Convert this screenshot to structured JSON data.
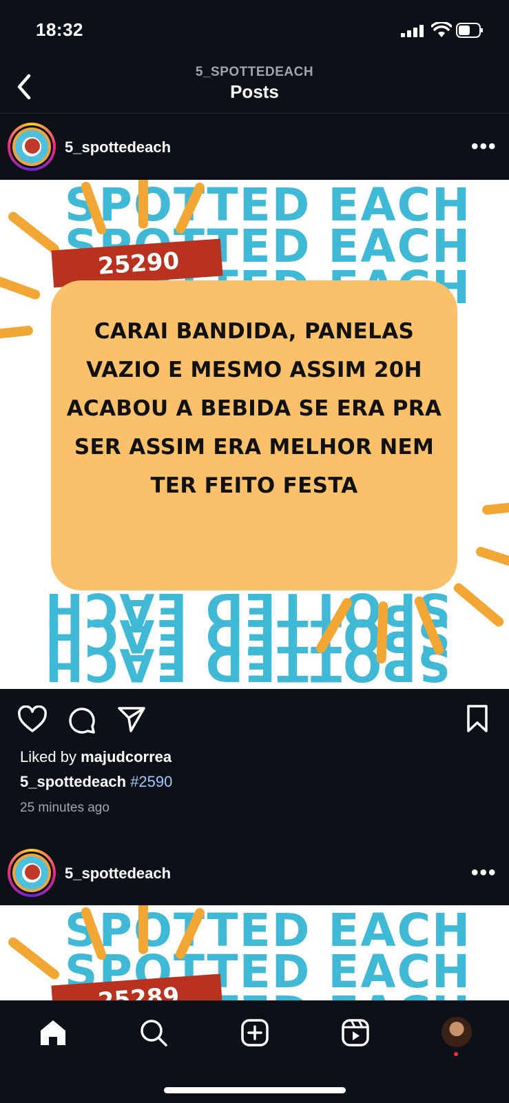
{
  "status_bar": {
    "time": "18:32",
    "icons": [
      "signal-icon",
      "wifi-icon",
      "battery-icon"
    ]
  },
  "header": {
    "username": "5_SPOTTEDEACH",
    "title": "Posts",
    "back_icon": "chevron-left-icon"
  },
  "posts": [
    {
      "username": "5_spottedeach",
      "image": {
        "background_word": "SPOTTED EACH",
        "number": "25290",
        "text": "CARAI BANDIDA, PANELAS VAZIO E MESMO ASSIM 20H ACABOU A BEBIDA SE ERA PRA SER ASSIM ERA MELHOR NEM TER FEITO FESTA",
        "colors": {
          "card": "#fbc16a",
          "tag": "#b8321f",
          "word": "#3fb9d6",
          "rays": "#f2a735"
        }
      },
      "likes_prefix": "Liked by ",
      "liked_by": "majudcorrea",
      "caption_user": "5_spottedeach",
      "caption_tag": "#2590",
      "time_ago": "25 minutes ago"
    },
    {
      "username": "5_spottedeach",
      "image": {
        "background_word": "SPOTTED EACH",
        "number": "25289"
      }
    }
  ],
  "nav": {
    "items": [
      "home-icon",
      "search-icon",
      "create-icon",
      "reels-icon",
      "profile-avatar"
    ]
  }
}
